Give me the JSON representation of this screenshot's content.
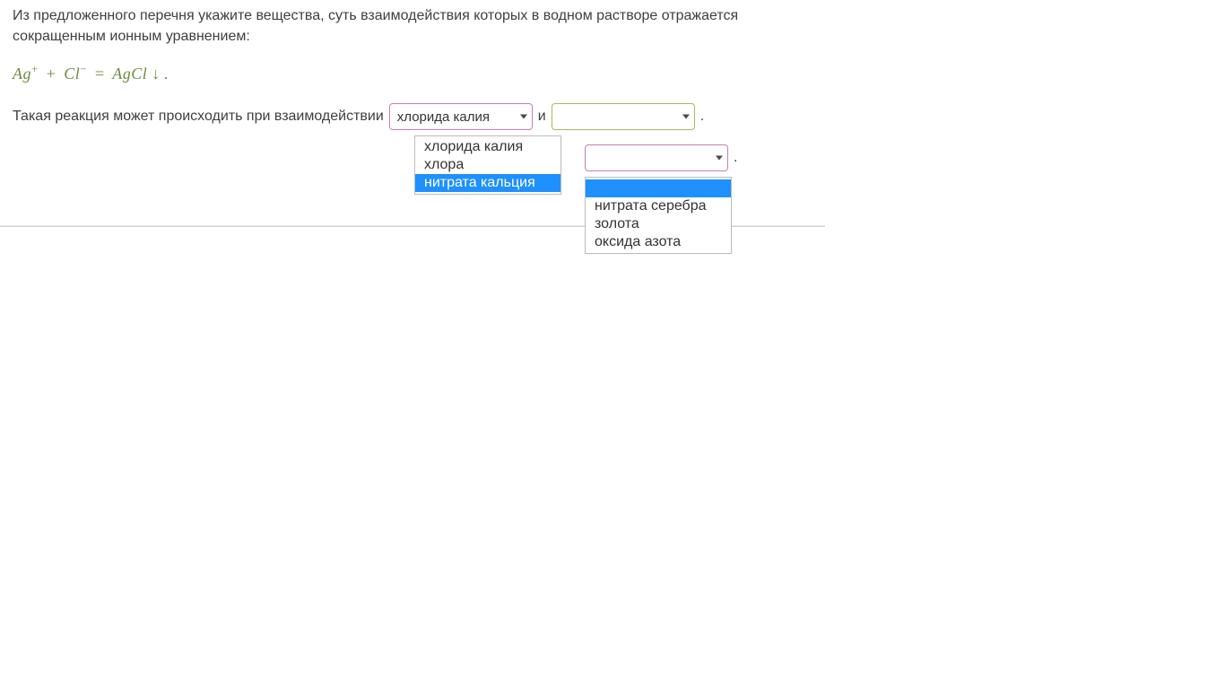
{
  "prompt_line1": "Из предложенного перечня укажите вещества, суть взаимодействия которых  в водном растворе отражается",
  "prompt_line2": "сокращенным ионным уравнением:",
  "equation": {
    "lhs_a": "Ag",
    "lhs_a_sup": "+",
    "plus": "+",
    "lhs_b": "Cl",
    "lhs_b_sup": "−",
    "eq": "=",
    "rhs": "AgCl",
    "arrow": "↓",
    "period": "."
  },
  "sentence_lead": "Такая реакция может происходить при взаимодействии",
  "conj": "и",
  "period": ".",
  "select1": {
    "value": "хлорида калия",
    "options": [
      "хлорида калия",
      "хлора",
      "нитрата кальция"
    ],
    "highlight_index": 2
  },
  "select2": {
    "value": ""
  },
  "select3": {
    "value": "",
    "options": [
      "",
      "нитрата серебра",
      "золота",
      "оксида азота"
    ],
    "highlight_index": 0
  }
}
